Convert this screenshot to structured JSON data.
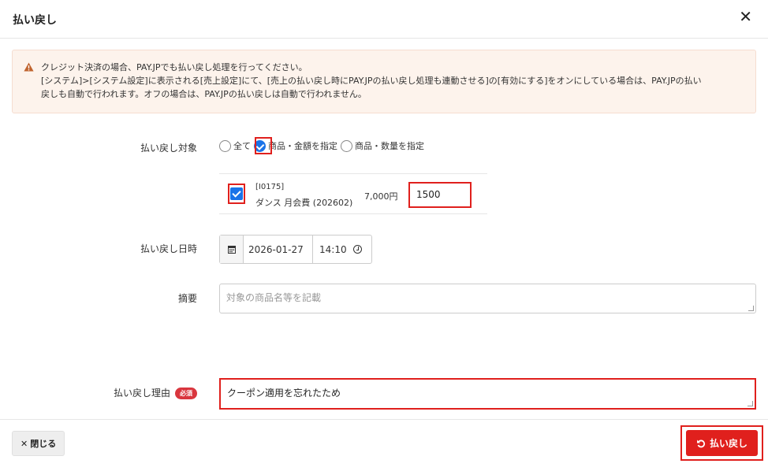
{
  "modal": {
    "title": "払い戻し",
    "close_symbol": "✕"
  },
  "alert": {
    "icon": "warning-icon",
    "lines": [
      "クレジット決済の場合、PAY.JPでも払い戻し処理を行ってください。",
      "[システム]>[システム設定]に表示される[売上設定]にて、[売上の払い戻し時にPAY.JPの払い戻し処理も連動させる]の[有効にする]をオンにしている場合は、PAY.JPの払い",
      "戻しも自動で行われます。オフの場合は、PAY.JPの払い戻しは自動で行われません。"
    ]
  },
  "target": {
    "label": "払い戻し対象",
    "options": [
      {
        "label": "全て",
        "checked": false
      },
      {
        "label": "商品・金額を指定",
        "checked": true
      },
      {
        "label": "商品・数量を指定",
        "checked": false
      }
    ]
  },
  "item": {
    "checked": true,
    "code": "[I0175]",
    "name": "ダンス 月会費 (202602)",
    "price": "7,000円",
    "amount": "1500"
  },
  "datetime": {
    "label": "払い戻し日時",
    "date": "2026-01-27",
    "time": "14:10"
  },
  "summary": {
    "label": "摘要",
    "placeholder": "対象の商品名等を記載",
    "value": ""
  },
  "reason": {
    "label": "払い戻し理由",
    "required_badge": "必須",
    "value": "クーポン適用を忘れたため"
  },
  "footer": {
    "close_label": "閉じる",
    "close_icon": "✕",
    "refund_label": "払い戻し",
    "refund_icon": "undo-icon"
  },
  "colors": {
    "primary": "#1a73e8",
    "danger": "#e0201d",
    "alert_bg": "#fdf3ec",
    "warning_icon": "#c0632e"
  }
}
